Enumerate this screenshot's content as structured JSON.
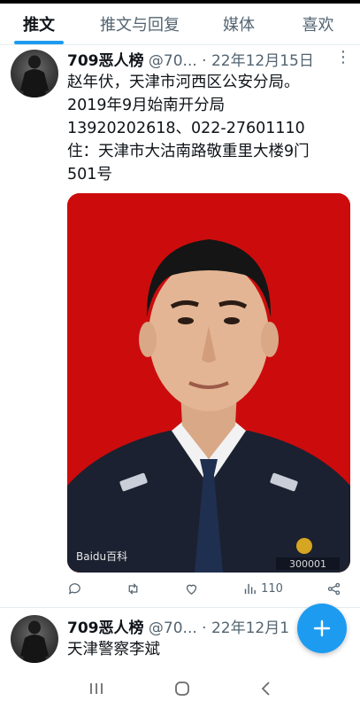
{
  "tabs": [
    {
      "label": "推文",
      "active": true
    },
    {
      "label": "推文与回复",
      "active": false
    },
    {
      "label": "媒体",
      "active": false
    },
    {
      "label": "喜欢",
      "active": false
    }
  ],
  "tweets": [
    {
      "name": "709恶人榜",
      "handle": "@70...",
      "sep": "·",
      "date": "22年12月15日",
      "lines": [
        "赵年伏，天津市河西区公安分局。",
        "2019年9月始南开分局",
        "13920202618、022-27601110",
        "住：天津市大沽南路敬重里大楼9门",
        "501号"
      ],
      "photo": {
        "watermark": "Baidu百科",
        "badge_number": "300001"
      },
      "actions": {
        "views_count": "110"
      }
    },
    {
      "name": "709恶人榜",
      "handle": "@70...",
      "sep": "·",
      "date": "22年12月1",
      "lines": [
        "天津警察李斌"
      ]
    }
  ],
  "fab": {
    "icon": "plus-icon"
  },
  "colors": {
    "accent": "#1d9bf0",
    "photo_bg": "#cc0c0c"
  },
  "navbar": {
    "icons": [
      "recent-apps-icon",
      "home-icon",
      "back-icon"
    ]
  }
}
